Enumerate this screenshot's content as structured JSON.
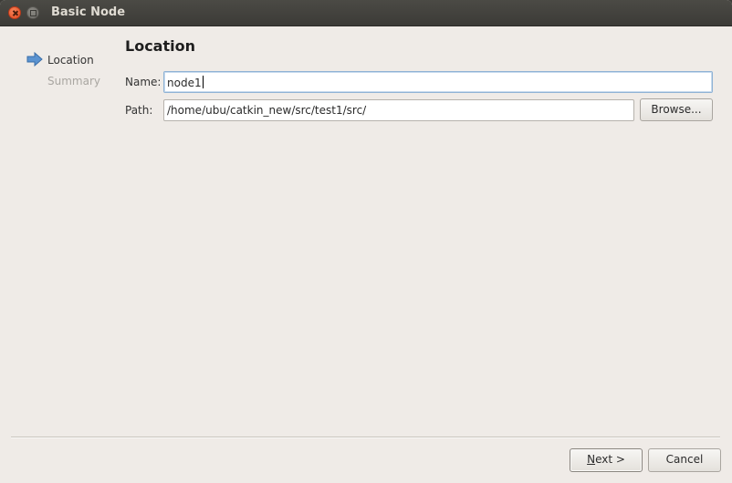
{
  "window": {
    "title": "Basic Node"
  },
  "sidebar": {
    "items": [
      {
        "label": "Location",
        "state": "active"
      },
      {
        "label": "Summary",
        "state": "inactive"
      }
    ]
  },
  "main": {
    "title": "Location",
    "name_label": "Name:",
    "name_value": "node1",
    "path_label": "Path:",
    "path_value": "/home/ubu/catkin_new/src/test1/src/",
    "browse_label": "Browse..."
  },
  "footer": {
    "next_mnemonic": "N",
    "next_rest": "ext >",
    "cancel_label": "Cancel"
  },
  "icons": {
    "close": "close-icon",
    "maximize": "maximize-icon",
    "step_arrow": "arrow-right-icon"
  },
  "colors": {
    "titlebar": "#3c3b37",
    "window_bg": "#efebe7",
    "close_button": "#e2481e",
    "step_arrow": "#5b93d0",
    "focus_border": "#8fb2d4"
  }
}
